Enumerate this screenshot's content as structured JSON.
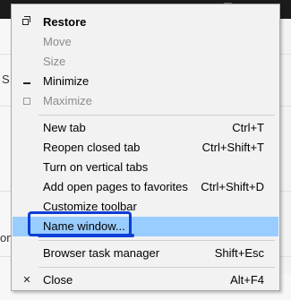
{
  "window": {
    "title_bar": {
      "restore_button_icon": "restore-icon",
      "close_button_icon": "close-icon"
    },
    "background_partial_text": [
      "S",
      "on"
    ]
  },
  "menu": {
    "items": [
      {
        "label": "Restore",
        "bold": true,
        "disabled": false,
        "icon": "restore-icon",
        "shortcut": ""
      },
      {
        "label": "Move",
        "bold": false,
        "disabled": true,
        "icon": "",
        "shortcut": ""
      },
      {
        "label": "Size",
        "bold": false,
        "disabled": true,
        "icon": "",
        "shortcut": ""
      },
      {
        "label": "Minimize",
        "bold": false,
        "disabled": false,
        "icon": "minimize-icon",
        "shortcut": ""
      },
      {
        "label": "Maximize",
        "bold": false,
        "disabled": true,
        "icon": "maximize-icon",
        "shortcut": ""
      },
      {
        "label": "New tab",
        "bold": false,
        "disabled": false,
        "icon": "",
        "shortcut": "Ctrl+T"
      },
      {
        "label": "Reopen closed tab",
        "bold": false,
        "disabled": false,
        "icon": "",
        "shortcut": "Ctrl+Shift+T"
      },
      {
        "label": "Turn on vertical tabs",
        "bold": false,
        "disabled": false,
        "icon": "",
        "shortcut": ""
      },
      {
        "label": "Add open pages to favorites",
        "bold": false,
        "disabled": false,
        "icon": "",
        "shortcut": "Ctrl+Shift+D"
      },
      {
        "label": "Customize toolbar",
        "bold": false,
        "disabled": false,
        "icon": "",
        "shortcut": ""
      },
      {
        "label": "Name window...",
        "bold": false,
        "disabled": false,
        "icon": "",
        "shortcut": "",
        "highlighted": true
      },
      {
        "label": "Browser task manager",
        "bold": false,
        "disabled": false,
        "icon": "",
        "shortcut": "Shift+Esc"
      },
      {
        "label": "Close",
        "bold": false,
        "disabled": false,
        "icon": "close-icon",
        "shortcut": "Alt+F4"
      }
    ]
  },
  "colors": {
    "menu_background": "#f2f2f2",
    "highlight": "#99ccff",
    "annotation": "#0a3fd6",
    "disabled_text": "#8b8b8b",
    "title_bar": "#1b1b1b"
  }
}
